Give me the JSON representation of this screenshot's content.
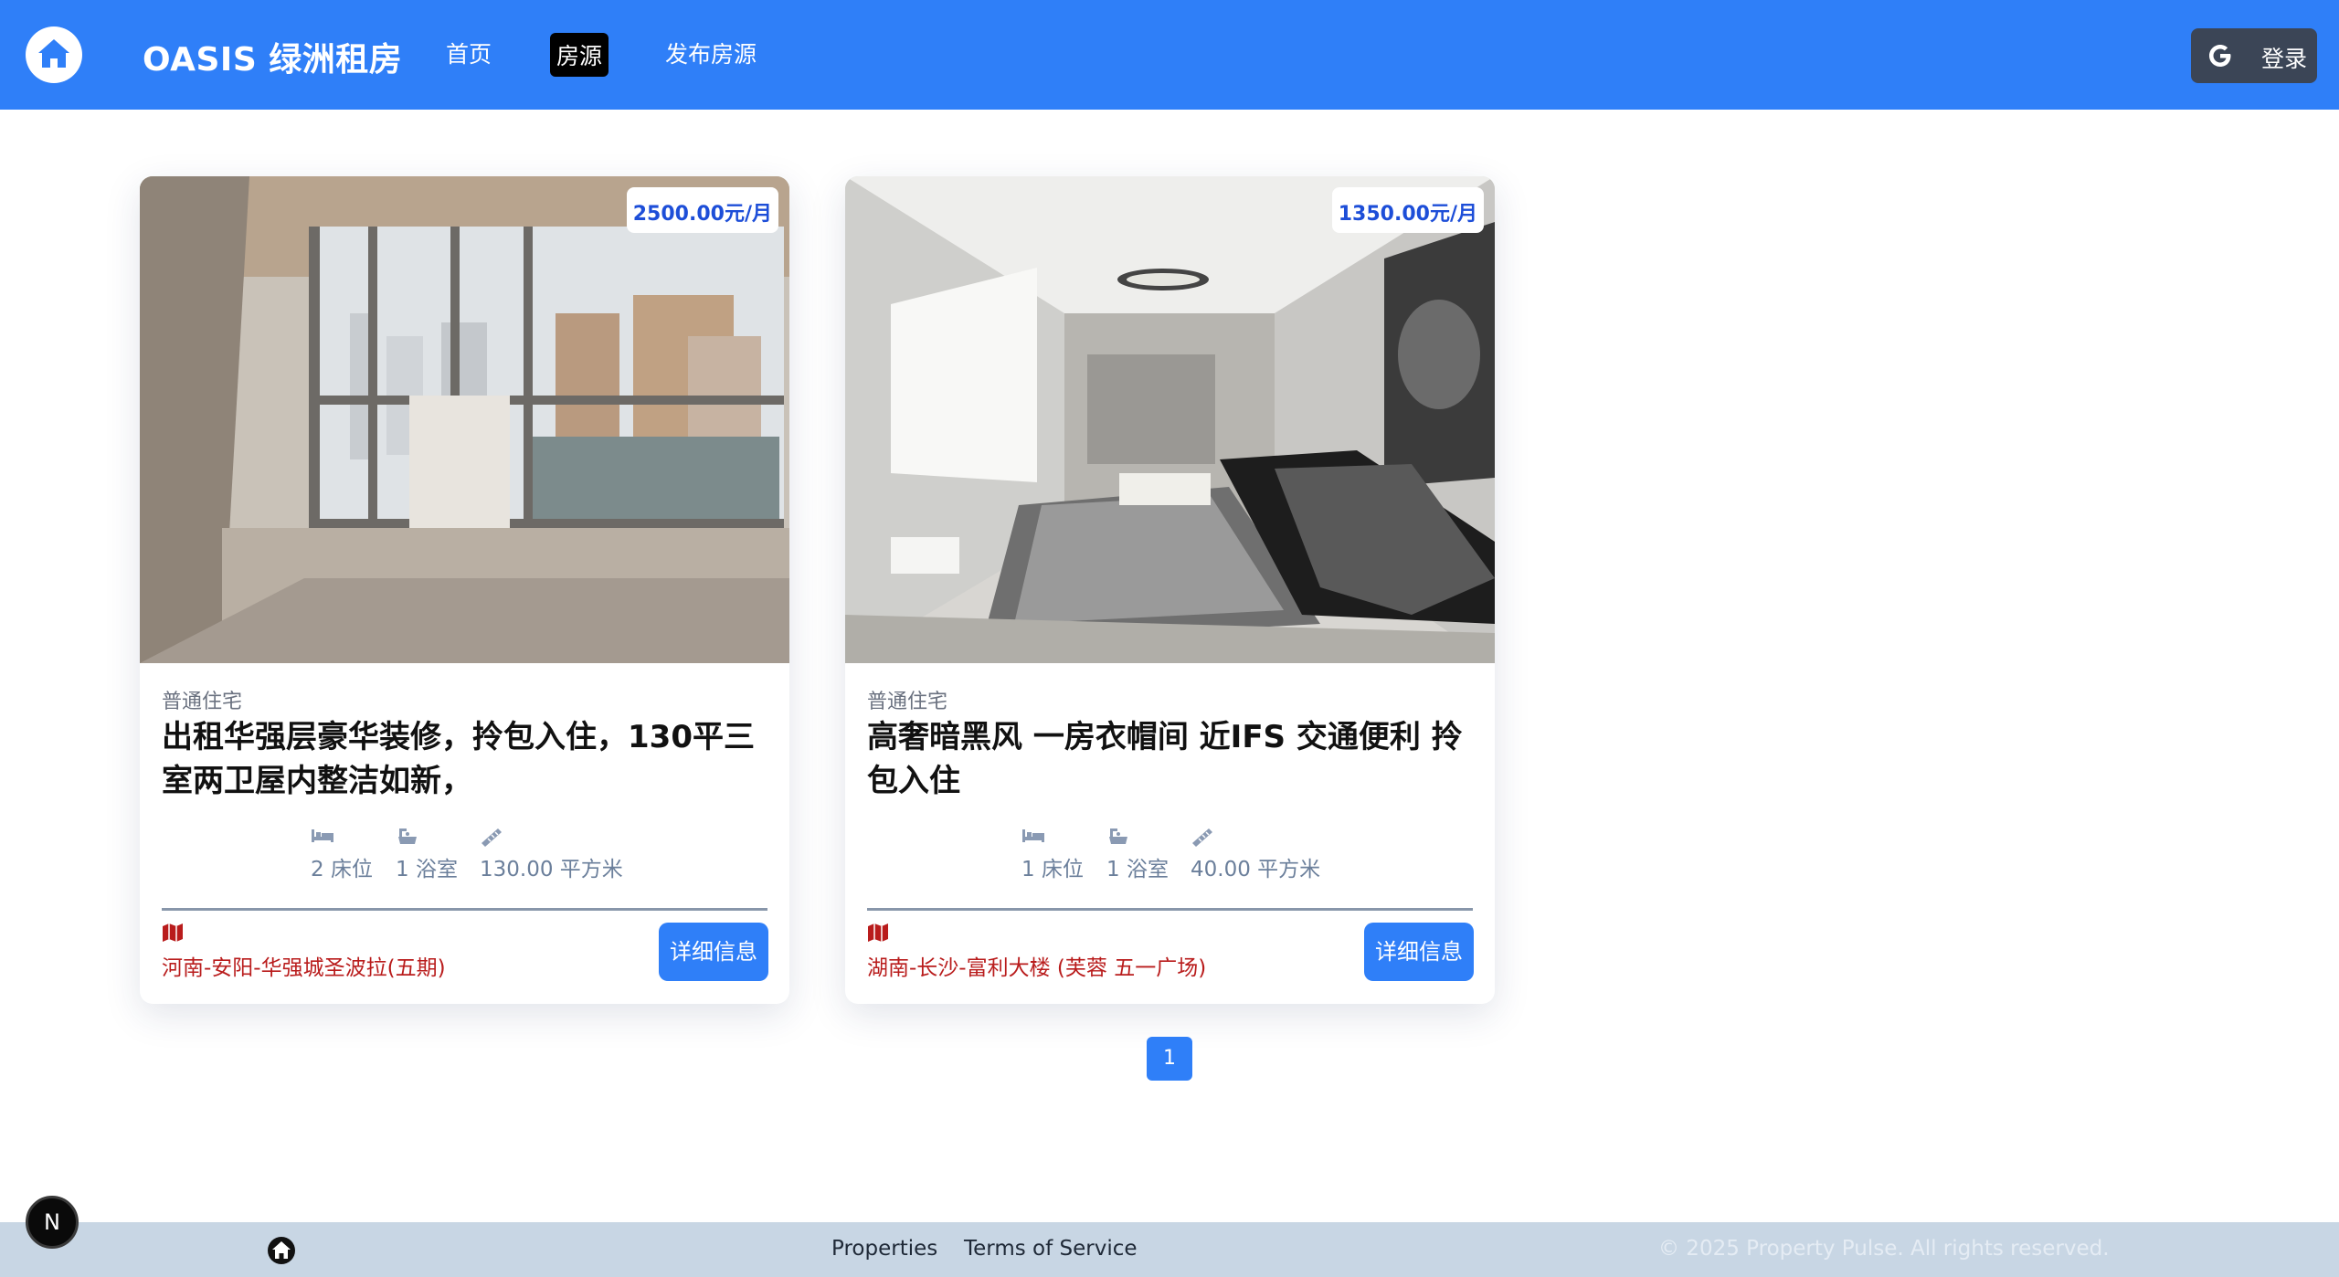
{
  "header": {
    "brand": "OASIS 绿洲租房",
    "nav": {
      "home": "首页",
      "properties": "房源",
      "add_property": "发布房源"
    },
    "login_label": "登录",
    "logo_icon": "house-icon",
    "google_icon": "google-icon",
    "bg_color": "#2f7ff8"
  },
  "listings": [
    {
      "type": "普通住宅",
      "title": "出租华强层豪华装修，拎包入住，130平三室两卫屋内整洁如新，",
      "price": "2500.00元/月",
      "beds": "2 床位",
      "baths": "1 浴室",
      "area": "130.00 平方米",
      "location": "河南-安阳-华强城圣波拉(五期)",
      "button_label": "详细信息",
      "image_desc_icon": "bedroom-window-photo"
    },
    {
      "type": "普通住宅",
      "title": "高奢暗黑风 一房衣帽间 近IFS 交通便利 拎包入住",
      "price": "1350.00元/月",
      "beds": "1 床位",
      "baths": "1 浴室",
      "area": "40.00 平方米",
      "location": "湖南-长沙-富利大楼 (芙蓉 五一广场)",
      "button_label": "详细信息",
      "image_desc_icon": "living-room-photo"
    }
  ],
  "pagination": {
    "current": "1"
  },
  "footer": {
    "links": [
      "Properties",
      "Terms of Service"
    ],
    "copyright": "© 2025 Property Pulse. All rights reserved.",
    "home_icon": "house-icon"
  },
  "dev_badge": "N",
  "colors": {
    "accent": "#2f7ff8",
    "price_text": "#1d4ed8",
    "location_text": "#b91c1c",
    "footer_bg": "#c8d6e4"
  }
}
